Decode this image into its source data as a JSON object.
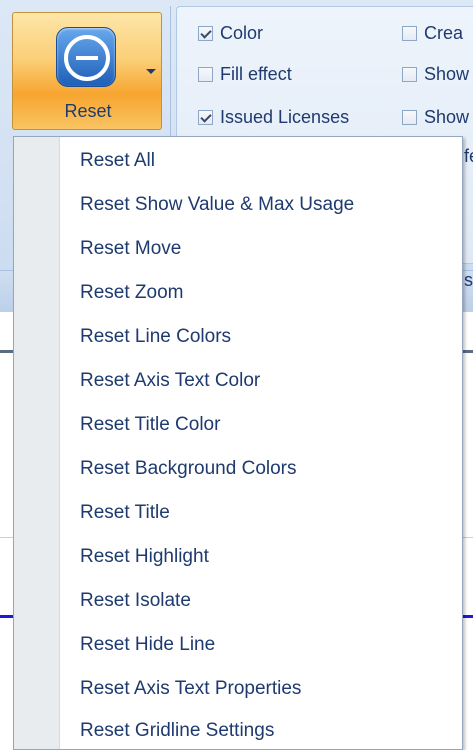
{
  "ribbon": {
    "reset_button": {
      "label": "Reset"
    },
    "checkboxes": [
      {
        "label": "Color",
        "checked": true
      },
      {
        "label": "Fill effect",
        "checked": false
      },
      {
        "label": "Issued Licenses",
        "checked": true
      },
      {
        "label": "Crea",
        "checked": false
      },
      {
        "label": "Show",
        "checked": false
      },
      {
        "label": "Show",
        "checked": false
      }
    ],
    "clipped_text": {
      "row4": "fe",
      "row7": "s"
    }
  },
  "reset_menu": {
    "items": [
      "Reset All",
      "Reset Show Value &  Max  Usage",
      "Reset Move",
      "Reset Zoom",
      "Reset Line Colors",
      "Reset Axis Text Color",
      "Reset Title Color",
      "Reset Background Colors",
      "Reset Title",
      "Reset Highlight",
      "Reset Isolate",
      "Reset Hide Line",
      "Reset Axis Text Properties",
      "Reset Gridline Settings"
    ]
  },
  "colors": {
    "text": "#1e3a6e",
    "ribbon_bg": "#d3e1f3",
    "button_orange": "#f7a530",
    "icon_blue": "#1e5fb8",
    "series_blue": "#1a1adf"
  },
  "icons": {
    "reset": "minus-circle-icon",
    "dropdown": "caret-down-icon"
  }
}
